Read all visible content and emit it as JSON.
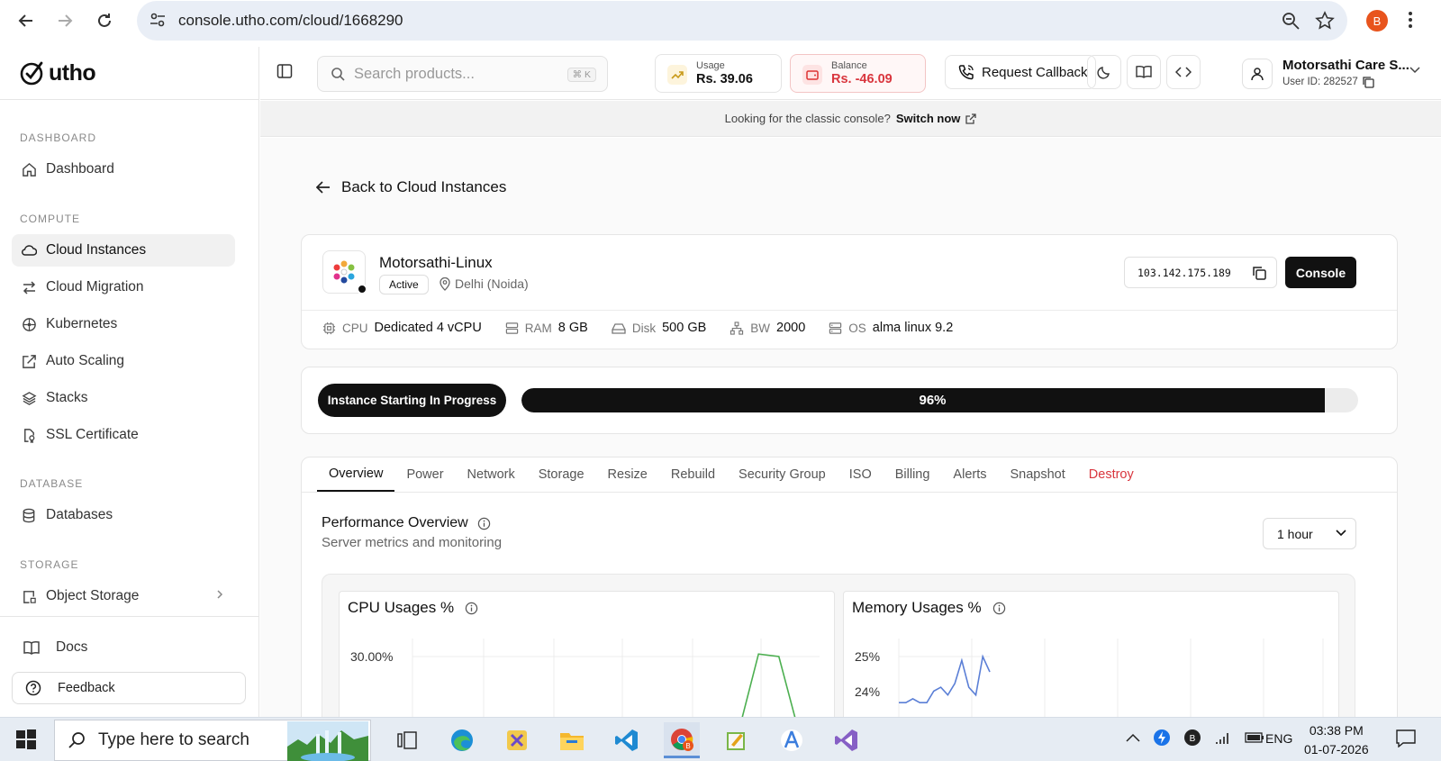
{
  "browser": {
    "url": "console.utho.com/cloud/1668290",
    "profile_initial": "B"
  },
  "sidebar": {
    "logo_text": "utho",
    "sections": [
      {
        "title": "DASHBOARD",
        "items": [
          {
            "label": "Dashboard",
            "icon": "home-icon"
          }
        ]
      },
      {
        "title": "COMPUTE",
        "items": [
          {
            "label": "Cloud Instances",
            "icon": "cloud-icon",
            "active": true
          },
          {
            "label": "Cloud Migration",
            "icon": "swap-icon"
          },
          {
            "label": "Kubernetes",
            "icon": "kubernetes-icon"
          },
          {
            "label": "Auto Scaling",
            "icon": "scale-icon"
          },
          {
            "label": "Stacks",
            "icon": "layers-icon"
          },
          {
            "label": "SSL Certificate",
            "icon": "certificate-icon"
          }
        ]
      },
      {
        "title": "DATABASE",
        "items": [
          {
            "label": "Databases",
            "icon": "database-icon"
          }
        ]
      },
      {
        "title": "STORAGE",
        "items": [
          {
            "label": "Object Storage",
            "icon": "bucket-icon"
          }
        ]
      }
    ],
    "docs_label": "Docs",
    "feedback_label": "Feedback"
  },
  "header": {
    "search_placeholder": "Search products...",
    "search_shortcut": "⌘ K",
    "usage_label": "Usage",
    "usage_value": "Rs. 39.06",
    "balance_label": "Balance",
    "balance_value": "Rs. -46.09",
    "callback_label": "Request Callback",
    "user_name": "Motorsathi Care S...",
    "user_id": "User ID: 282527"
  },
  "notice": {
    "text": "Looking for the classic console?",
    "link": "Switch now"
  },
  "instance": {
    "back_label": "Back to Cloud Instances",
    "name": "Motorsathi-Linux",
    "status": "Active",
    "location": "Delhi (Noida)",
    "ip": "103.142.175.189",
    "console_label": "Console",
    "specs": [
      {
        "key": "CPU",
        "value": "Dedicated 4 vCPU",
        "icon": "cpu-icon"
      },
      {
        "key": "RAM",
        "value": "8 GB",
        "icon": "ram-icon"
      },
      {
        "key": "Disk",
        "value": "500 GB",
        "icon": "disk-icon"
      },
      {
        "key": "BW",
        "value": "2000",
        "icon": "network-icon"
      },
      {
        "key": "OS",
        "value": "alma linux 9.2",
        "icon": "server-icon"
      }
    ]
  },
  "progress": {
    "label": "Instance Starting In Progress",
    "percent": 96,
    "percent_text": "96%"
  },
  "tabs": [
    "Overview",
    "Power",
    "Network",
    "Storage",
    "Resize",
    "Rebuild",
    "Security Group",
    "ISO",
    "Billing",
    "Alerts",
    "Snapshot",
    "Destroy"
  ],
  "active_tab": "Overview",
  "performance": {
    "title": "Performance Overview",
    "subtitle": "Server metrics and monitoring",
    "range": "1 hour"
  },
  "chart_data": [
    {
      "type": "line",
      "title": "CPU Usages %",
      "y_ticks": [
        "30.00%"
      ],
      "color": "#4caf50",
      "x": [
        0,
        1,
        2,
        3,
        4,
        5,
        6,
        7,
        8,
        9,
        10,
        11,
        12,
        13,
        14,
        15,
        16,
        17,
        18,
        19,
        20
      ],
      "values": [
        0,
        0,
        0,
        0,
        0,
        0,
        0,
        0,
        0,
        0,
        0,
        0,
        0,
        0,
        0,
        0,
        0,
        31,
        30,
        0,
        0
      ]
    },
    {
      "type": "line",
      "title": "Memory Usages %",
      "y_ticks": [
        "25%",
        "24%"
      ],
      "color": "#5b7fd6",
      "x": [
        0,
        1,
        2,
        3,
        4,
        5,
        6,
        7,
        8,
        9,
        10,
        11,
        12,
        13
      ],
      "values": [
        23.8,
        23.8,
        23.9,
        23.8,
        23.8,
        24.1,
        24.2,
        24.0,
        24.3,
        24.9,
        24.2,
        24.0,
        25.0,
        24.6
      ]
    }
  ],
  "taskbar": {
    "search_placeholder": "Type here to search",
    "lang": "ENG",
    "time": "03:38 PM",
    "date": "01-07-2026"
  }
}
